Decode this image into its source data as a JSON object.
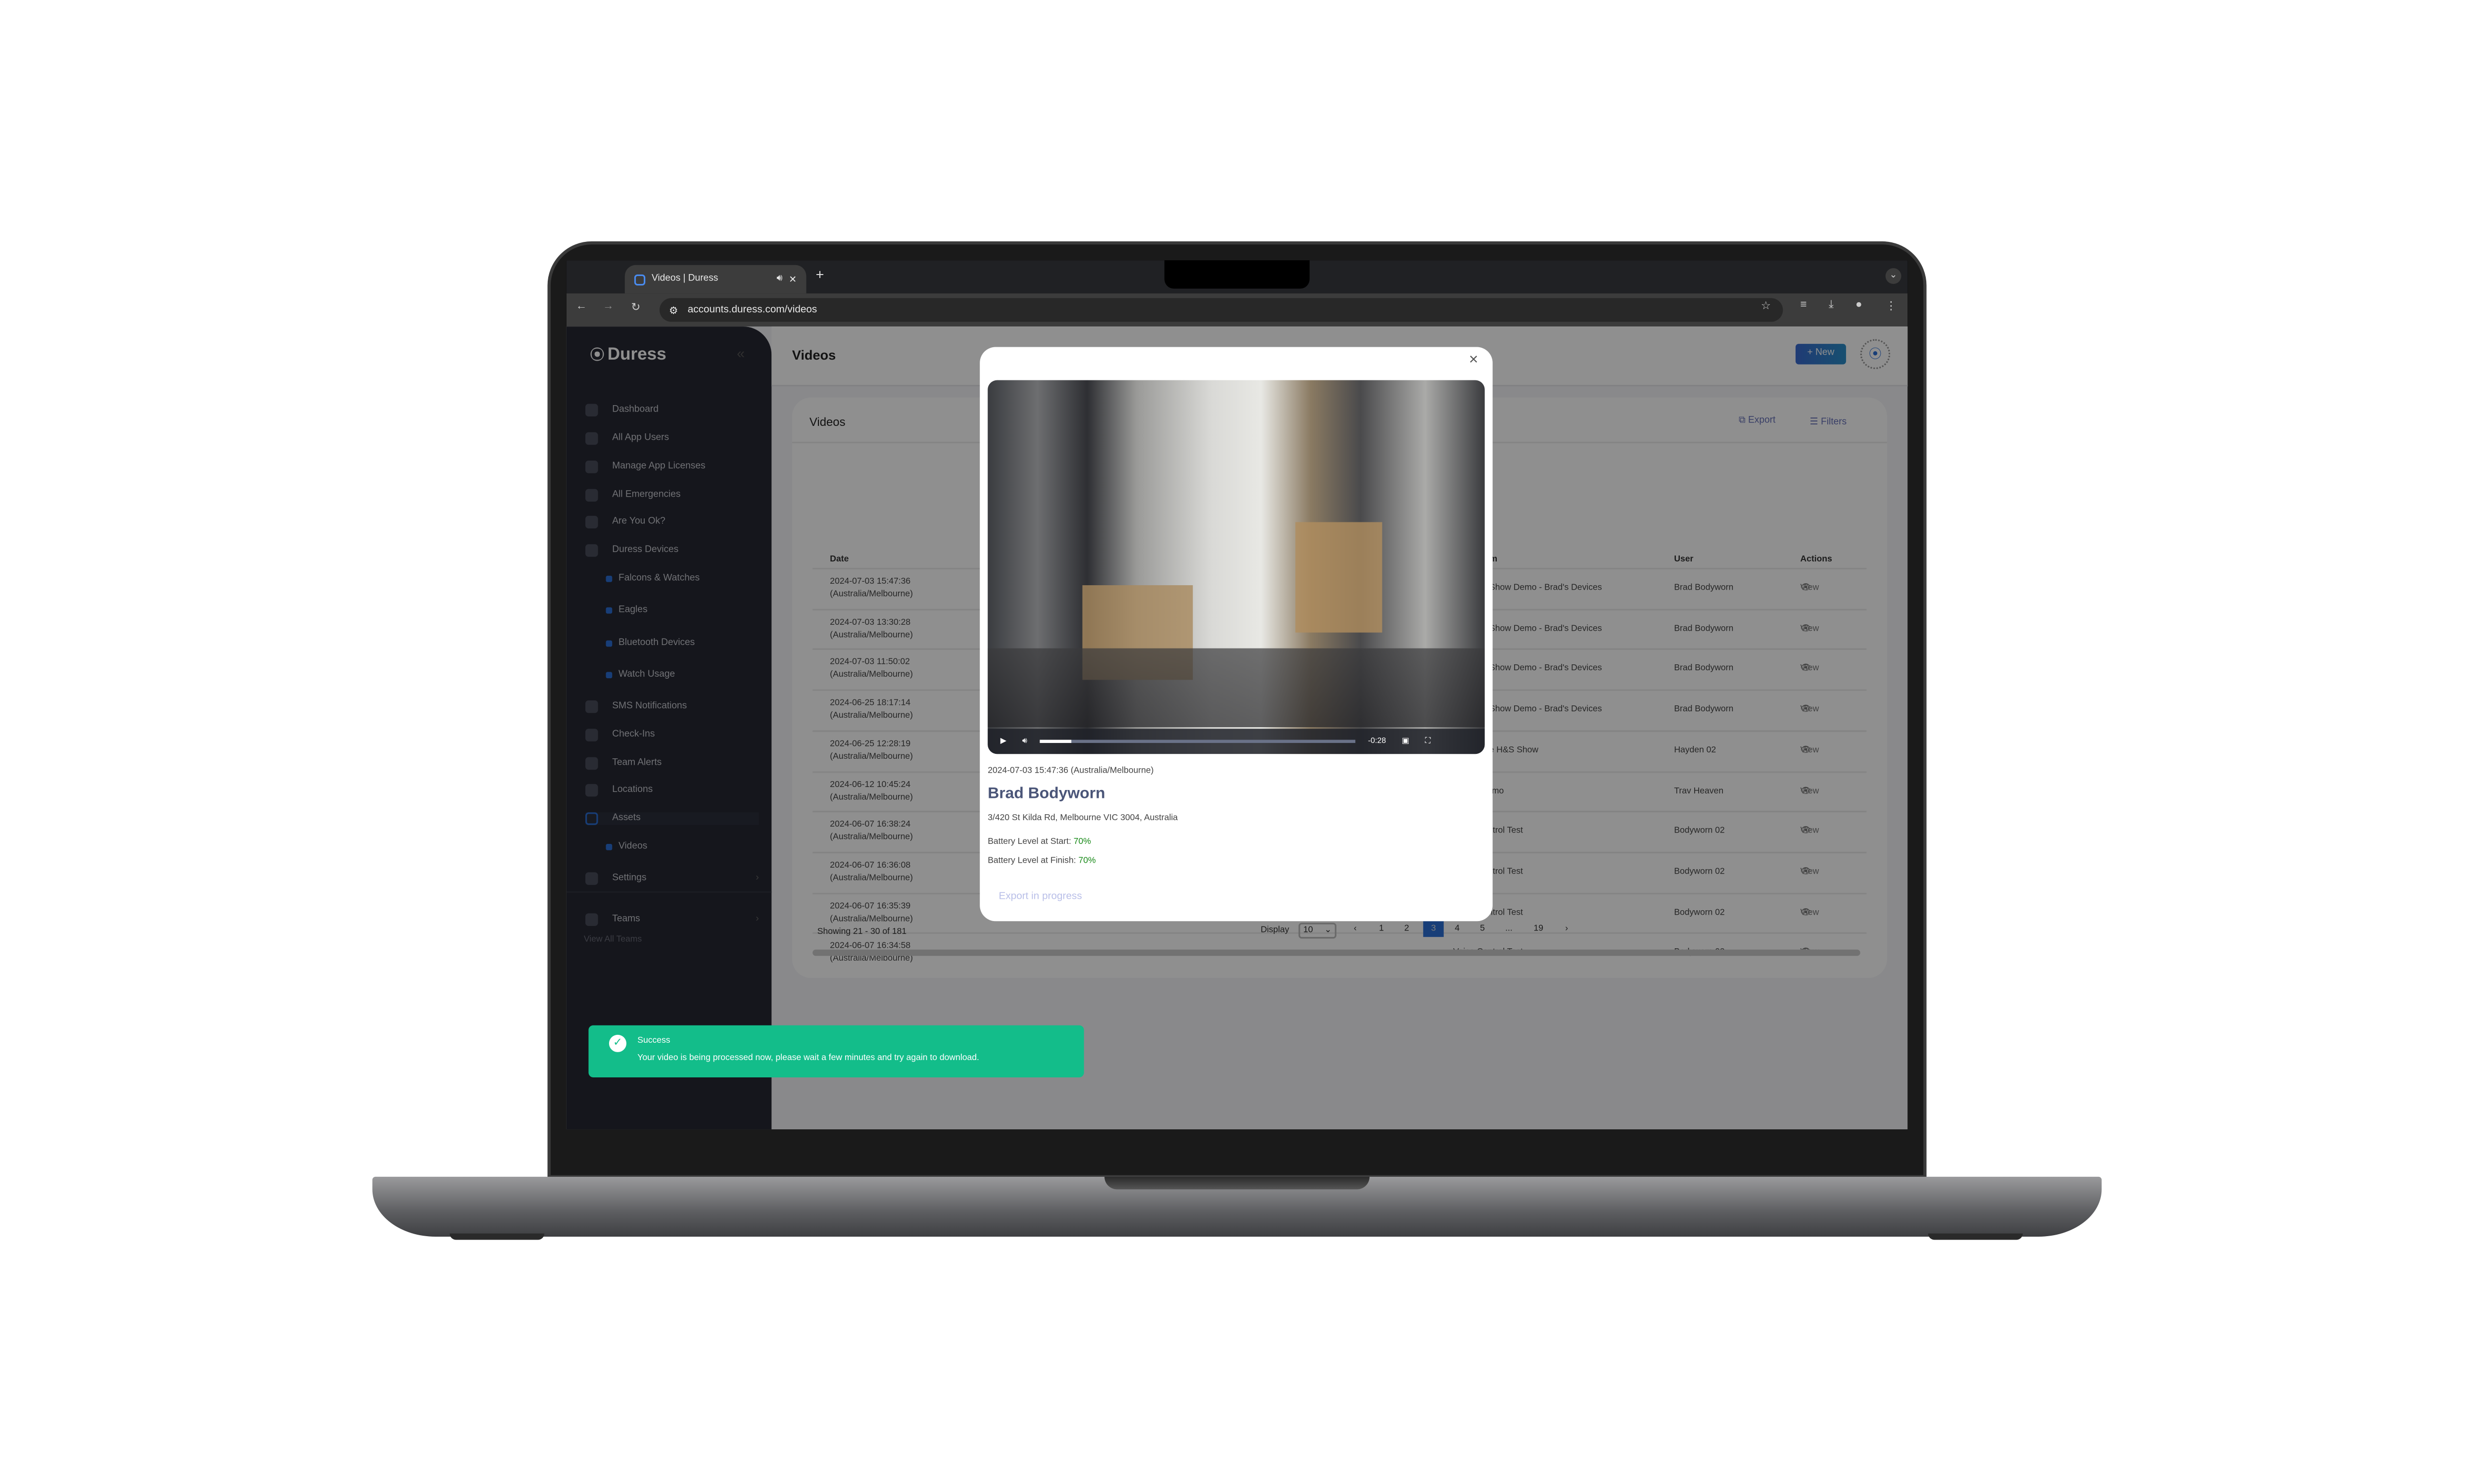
{
  "browser": {
    "tab_title": "Videos | Duress",
    "url": "accounts.duress.com/videos",
    "new_tab_label": "+"
  },
  "sidebar": {
    "brand": "Duress",
    "items": [
      {
        "label": "Dashboard",
        "icon": "diamond-icon"
      },
      {
        "label": "All App Users",
        "icon": "phone-icon"
      },
      {
        "label": "Manage App Licenses",
        "icon": "grid-dots-icon"
      },
      {
        "label": "All Emergencies",
        "icon": "warning-icon"
      },
      {
        "label": "Are You Ok?",
        "icon": "thumbs-up-icon"
      },
      {
        "label": "Duress Devices",
        "icon": "device-icon"
      },
      {
        "label": "Falcons & Watches",
        "sub": true
      },
      {
        "label": "Eagles",
        "sub": true
      },
      {
        "label": "Bluetooth Devices",
        "sub": true
      },
      {
        "label": "Watch Usage",
        "sub": true
      },
      {
        "label": "SMS Notifications",
        "icon": "chat-icon"
      },
      {
        "label": "Check-Ins",
        "icon": "location-pin-icon"
      },
      {
        "label": "Team Alerts",
        "icon": "people-icon"
      },
      {
        "label": "Locations",
        "icon": "crosshair-icon"
      },
      {
        "label": "Assets",
        "icon": "window-icon",
        "active": true
      },
      {
        "label": "Videos",
        "sub": true
      },
      {
        "label": "Settings",
        "icon": "gear-icon",
        "chevron": true
      },
      {
        "label": "Teams",
        "icon": "grid-icon",
        "chevron": true
      }
    ],
    "view_all_teams": "View All Teams"
  },
  "header": {
    "title": "Videos",
    "new_button": "+ New"
  },
  "card": {
    "title": "Videos",
    "export_label": "Export",
    "filters_label": "Filters",
    "columns": {
      "date": "Date",
      "team": "Team",
      "user": "User",
      "actions": "Actions"
    },
    "rows": [
      {
        "date": "2024-07-03 15:47:36",
        "tz": "(Australia/Melbourne)",
        "team": "Australia Show Demo - Brad's Devices",
        "user": "Brad Bodyworn",
        "action": "View"
      },
      {
        "date": "2024-07-03 13:30:28",
        "tz": "(Australia/Melbourne)",
        "team": "Australia Show Demo - Brad's Devices",
        "user": "Brad Bodyworn",
        "action": "View"
      },
      {
        "date": "2024-07-03 11:50:02",
        "tz": "(Australia/Melbourne)",
        "team": "Australia Show Demo - Brad's Devices",
        "user": "Brad Bodyworn",
        "action": "View"
      },
      {
        "date": "2024-06-25 18:17:14",
        "tz": "(Australia/Melbourne)",
        "team": "Australia Show Demo - Brad's Devices",
        "user": "Brad Bodyworn",
        "action": "View"
      },
      {
        "date": "2024-06-25 12:28:19",
        "tz": "(Australia/Melbourne)",
        "team": "Workplace H&S Show",
        "user": "Hayden 02",
        "action": "View"
      },
      {
        "date": "2024-06-12 10:45:24",
        "tz": "(Australia/Melbourne)",
        "team": "Emma Demo",
        "user": "Trav Heaven",
        "action": "View"
      },
      {
        "date": "2024-06-07 16:38:24",
        "tz": "(Australia/Melbourne)",
        "team": "Voice Control Test",
        "user": "Bodyworn 02",
        "action": "View"
      },
      {
        "date": "2024-06-07 16:36:08",
        "tz": "(Australia/Melbourne)",
        "team": "Voice Control Test",
        "user": "Bodyworn 02",
        "action": "View"
      },
      {
        "date": "2024-06-07 16:35:39",
        "tz": "(Australia/Melbourne)",
        "team": "Voice Control Test",
        "user": "Bodyworn 02",
        "action": "View"
      },
      {
        "date": "2024-06-07 16:34:58",
        "tz": "(Australia/Melbourne)",
        "team": "Voice Control Test",
        "user": "Bodyworn 02",
        "action": "View"
      }
    ],
    "showing": "Showing 21 - 30 of 181",
    "display_label": "Display",
    "display_value": "10",
    "pages": [
      "1",
      "2",
      "3",
      "4",
      "5",
      "...",
      "19"
    ],
    "current_page": "3"
  },
  "modal": {
    "video_time_remaining": "-0:28",
    "video_progress_fraction": 0.1,
    "timestamp": "2024-07-03 15:47:36 (Australia/Melbourne)",
    "name": "Brad Bodyworn",
    "address": "3/420 St Kilda Rd, Melbourne VIC 3004, Australia",
    "battery_start_label": "Battery Level at Start:",
    "battery_start": "70%",
    "battery_finish_label": "Battery Level at Finish:",
    "battery_finish": "70%",
    "export_status": "Export in progress"
  },
  "toast": {
    "title": "Success",
    "message": "Your video is being processed now, please wait a few minutes and try again to download."
  },
  "colors": {
    "accent": "#2c6fd6",
    "success": "#13bd8a",
    "battery_ok": "#1a8a1a",
    "sidebar": "#262833"
  }
}
